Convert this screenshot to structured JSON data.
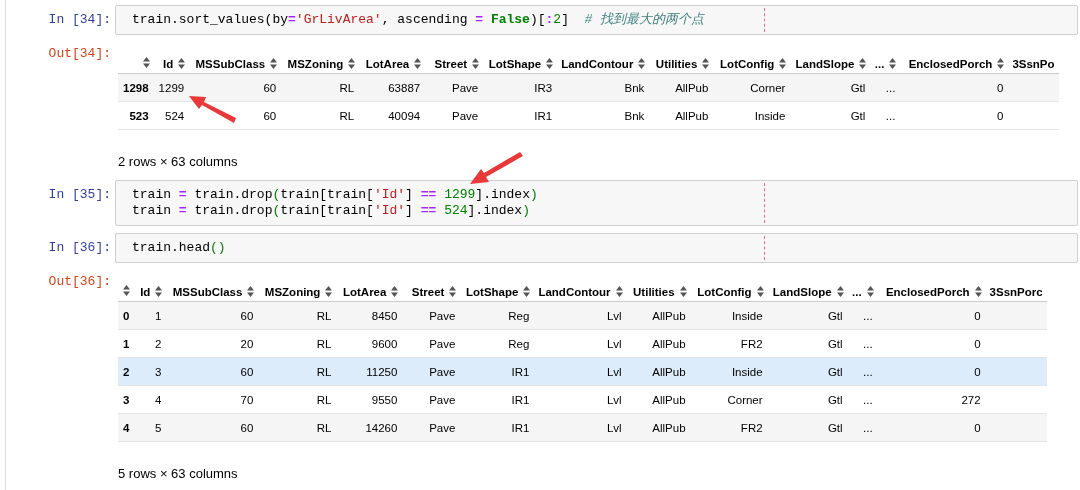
{
  "cells": [
    {
      "kind": "code",
      "prompt": "In [34]:",
      "lines": [
        [
          {
            "kind": "plain",
            "text": "train.sort_values(by"
          },
          {
            "kind": "op",
            "text": "="
          },
          {
            "kind": "str",
            "text": "'GrLivArea'"
          },
          {
            "kind": "plain",
            "text": ", ascending "
          },
          {
            "kind": "op",
            "text": "="
          },
          {
            "kind": "kw",
            "text": " False"
          },
          {
            "kind": "plain",
            "text": ")["
          },
          {
            "kind": "op",
            "text": ":"
          },
          {
            "kind": "num",
            "text": "2"
          },
          {
            "kind": "plain",
            "text": "]  "
          },
          {
            "kind": "comment",
            "text": "# 找到最大的两个点"
          }
        ]
      ]
    },
    {
      "kind": "output",
      "prompt": "Out[34]:",
      "table": {
        "columns": [
          "Id",
          "MSSubClass",
          "MSZoning",
          "LotArea",
          "Street",
          "LotShape",
          "LandContour",
          "Utilities",
          "LotConfig",
          "LandSlope",
          "...",
          "EnclosedPorch",
          "3SsnPo"
        ],
        "rows": [
          {
            "index": "1298",
            "selected": false,
            "cells": [
              "1299",
              "60",
              "RL",
              "63887",
              "Pave",
              "IR3",
              "Bnk",
              "AllPub",
              "Corner",
              "Gtl",
              "...",
              "0"
            ]
          },
          {
            "index": "523",
            "selected": false,
            "cells": [
              "524",
              "60",
              "RL",
              "40094",
              "Pave",
              "IR1",
              "Bnk",
              "AllPub",
              "Inside",
              "Gtl",
              "...",
              "0"
            ]
          }
        ]
      },
      "footer": "2 rows × 63 columns"
    },
    {
      "kind": "code",
      "prompt": "In [35]:",
      "lines": [
        [
          {
            "kind": "plain",
            "text": "train "
          },
          {
            "kind": "op",
            "text": "="
          },
          {
            "kind": "plain",
            "text": " train.drop"
          },
          {
            "kind": "paren",
            "text": "("
          },
          {
            "kind": "plain",
            "text": "train[train["
          },
          {
            "kind": "str",
            "text": "'Id'"
          },
          {
            "kind": "plain",
            "text": "] "
          },
          {
            "kind": "op",
            "text": "=="
          },
          {
            "kind": "num",
            "text": " 1299"
          },
          {
            "kind": "plain",
            "text": "].index"
          },
          {
            "kind": "paren",
            "text": ")"
          }
        ],
        [
          {
            "kind": "plain",
            "text": "train "
          },
          {
            "kind": "op",
            "text": "="
          },
          {
            "kind": "plain",
            "text": " train.drop"
          },
          {
            "kind": "paren",
            "text": "("
          },
          {
            "kind": "plain",
            "text": "train[train["
          },
          {
            "kind": "str",
            "text": "'Id'"
          },
          {
            "kind": "plain",
            "text": "] "
          },
          {
            "kind": "op",
            "text": "=="
          },
          {
            "kind": "num",
            "text": " 524"
          },
          {
            "kind": "plain",
            "text": "].index"
          },
          {
            "kind": "paren",
            "text": ")"
          }
        ]
      ]
    },
    {
      "kind": "code",
      "prompt": "In [36]:",
      "lines": [
        [
          {
            "kind": "plain",
            "text": "train.head"
          },
          {
            "kind": "paren",
            "text": "()"
          }
        ]
      ]
    },
    {
      "kind": "output",
      "prompt": "Out[36]:",
      "table": {
        "columns": [
          "Id",
          "MSSubClass",
          "MSZoning",
          "LotArea",
          "Street",
          "LotShape",
          "LandContour",
          "Utilities",
          "LotConfig",
          "LandSlope",
          "...",
          "EnclosedPorch",
          "3SsnPorc"
        ],
        "rows": [
          {
            "index": "0",
            "selected": false,
            "cells": [
              "1",
              "60",
              "RL",
              "8450",
              "Pave",
              "Reg",
              "Lvl",
              "AllPub",
              "Inside",
              "Gtl",
              "...",
              "0"
            ]
          },
          {
            "index": "1",
            "selected": false,
            "cells": [
              "2",
              "20",
              "RL",
              "9600",
              "Pave",
              "Reg",
              "Lvl",
              "AllPub",
              "FR2",
              "Gtl",
              "...",
              "0"
            ]
          },
          {
            "index": "2",
            "selected": true,
            "cells": [
              "3",
              "60",
              "RL",
              "11250",
              "Pave",
              "IR1",
              "Lvl",
              "AllPub",
              "Inside",
              "Gtl",
              "...",
              "0"
            ]
          },
          {
            "index": "3",
            "selected": false,
            "cells": [
              "4",
              "70",
              "RL",
              "9550",
              "Pave",
              "IR1",
              "Lvl",
              "AllPub",
              "Corner",
              "Gtl",
              "...",
              "272"
            ]
          },
          {
            "index": "4",
            "selected": false,
            "cells": [
              "5",
              "60",
              "RL",
              "14260",
              "Pave",
              "IR1",
              "Lvl",
              "AllPub",
              "FR2",
              "Gtl",
              "...",
              "0"
            ]
          }
        ]
      },
      "footer": "5 rows × 63 columns"
    }
  ]
}
